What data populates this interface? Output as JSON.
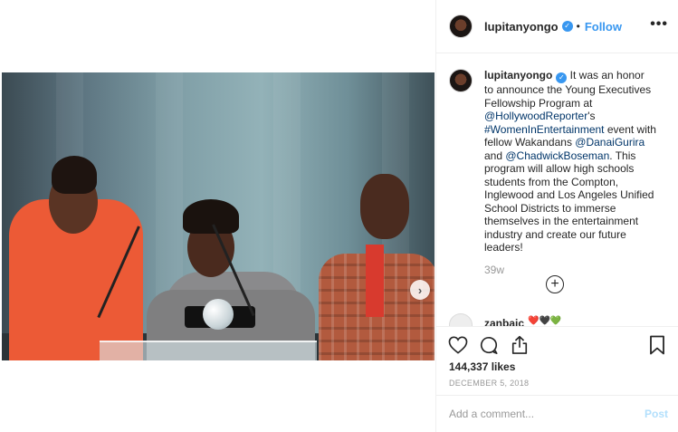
{
  "post": {
    "username": "lupitanyongo",
    "verified_glyph": "✓",
    "dot": "•",
    "follow_label": "Follow",
    "more_label": "•••",
    "next_photo_glyph": "›"
  },
  "caption": {
    "username": "lupitanyongo",
    "text_1": " It was an honor to announce the Young Executives Fellowship Program at ",
    "mention_1": "@HollywoodReporter",
    "text_2": "'s ",
    "hashtag": "#WomenInEntertainment",
    "text_3": " event with fellow Wakandans ",
    "mention_2": "@DanaiGurira",
    "text_4": " and ",
    "mention_3": "@ChadwickBoseman",
    "text_5": ". This program will allow high schools students from the Compton, Inglewood and Los Angeles Unified School Districts to immerse themselves in the entertainment industry and create our future leaders!",
    "age": "39w"
  },
  "load_more_glyph": "+",
  "next_comment": {
    "username": "zanbaic",
    "emoji": "❤️🖤💚"
  },
  "actions": {
    "likes": "144,337 likes",
    "date": "DECEMBER 5, 2018",
    "icons": [
      "heart-icon",
      "comment-icon",
      "share-icon",
      "bookmark-icon"
    ]
  },
  "comment_box": {
    "placeholder": "Add a comment...",
    "post_label": "Post"
  },
  "colors": {
    "link": "#003569",
    "accent": "#3897f0",
    "post_disabled": "#b2dffc",
    "muted": "#999999"
  }
}
